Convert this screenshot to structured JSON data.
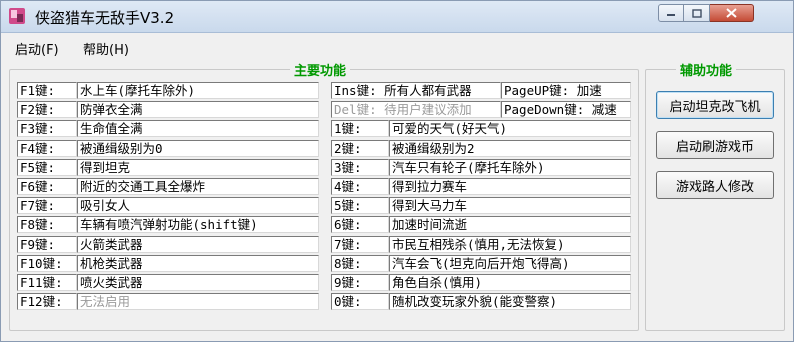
{
  "window": {
    "title": "侠盗猎车无敌手V3.2"
  },
  "menu": {
    "items": [
      "启动(F)",
      "帮助(H)"
    ]
  },
  "main_group": {
    "title": "主要功能",
    "left_rows": [
      {
        "key": "F1键:",
        "value": "水上车(摩托车除外)",
        "disabled": false
      },
      {
        "key": "F2键:",
        "value": "防弹衣全满",
        "disabled": false
      },
      {
        "key": "F3键:",
        "value": "生命值全满",
        "disabled": false
      },
      {
        "key": "F4键:",
        "value": "被通缉级别为0",
        "disabled": false
      },
      {
        "key": "F5键:",
        "value": "得到坦克",
        "disabled": false
      },
      {
        "key": "F6键:",
        "value": "附近的交通工具全爆炸",
        "disabled": false
      },
      {
        "key": "F7键:",
        "value": "吸引女人",
        "disabled": false
      },
      {
        "key": "F8键:",
        "value": "车辆有喷汽弹射功能(shift键)",
        "disabled": false
      },
      {
        "key": "F9键:",
        "value": "火箭类武器",
        "disabled": false
      },
      {
        "key": "F10键:",
        "value": "机枪类武器",
        "disabled": false
      },
      {
        "key": "F11键:",
        "value": "喷火类武器",
        "disabled": false
      },
      {
        "key": "F12键:",
        "value": "无法启用",
        "disabled": true
      }
    ],
    "right_rows": [
      {
        "key": "Ins键: 所有人都有武器",
        "value": "PageUP键: 加速",
        "disabled": false
      },
      {
        "key": "Del键: 待用户建议添加",
        "value": "PageDown键: 减速",
        "disabled": false,
        "key_disabled": true
      },
      {
        "key": "1键:",
        "value": "可爱的天气(好天气)",
        "disabled": false
      },
      {
        "key": "2键:",
        "value": "被通缉级别为2",
        "disabled": false
      },
      {
        "key": "3键:",
        "value": "汽车只有轮子(摩托车除外)",
        "disabled": false
      },
      {
        "key": "4键:",
        "value": "得到拉力赛车",
        "disabled": false
      },
      {
        "key": "5键:",
        "value": "得到大马力车",
        "disabled": false
      },
      {
        "key": "6键:",
        "value": "加速时间流逝",
        "disabled": false
      },
      {
        "key": "7键:",
        "value": "市民互相残杀(慎用,无法恢复)",
        "disabled": false
      },
      {
        "key": "8键:",
        "value": "汽车会飞(坦克向后开炮飞得高)",
        "disabled": false
      },
      {
        "key": "9键:",
        "value": "角色自杀(慎用)",
        "disabled": false
      },
      {
        "key": "0键:",
        "value": "随机改变玩家外貌(能变警察)",
        "disabled": false
      }
    ]
  },
  "aux_group": {
    "title": "辅助功能",
    "buttons": [
      "启动坦克改飞机",
      "启动刷游戏币",
      "游戏路人修改"
    ]
  }
}
